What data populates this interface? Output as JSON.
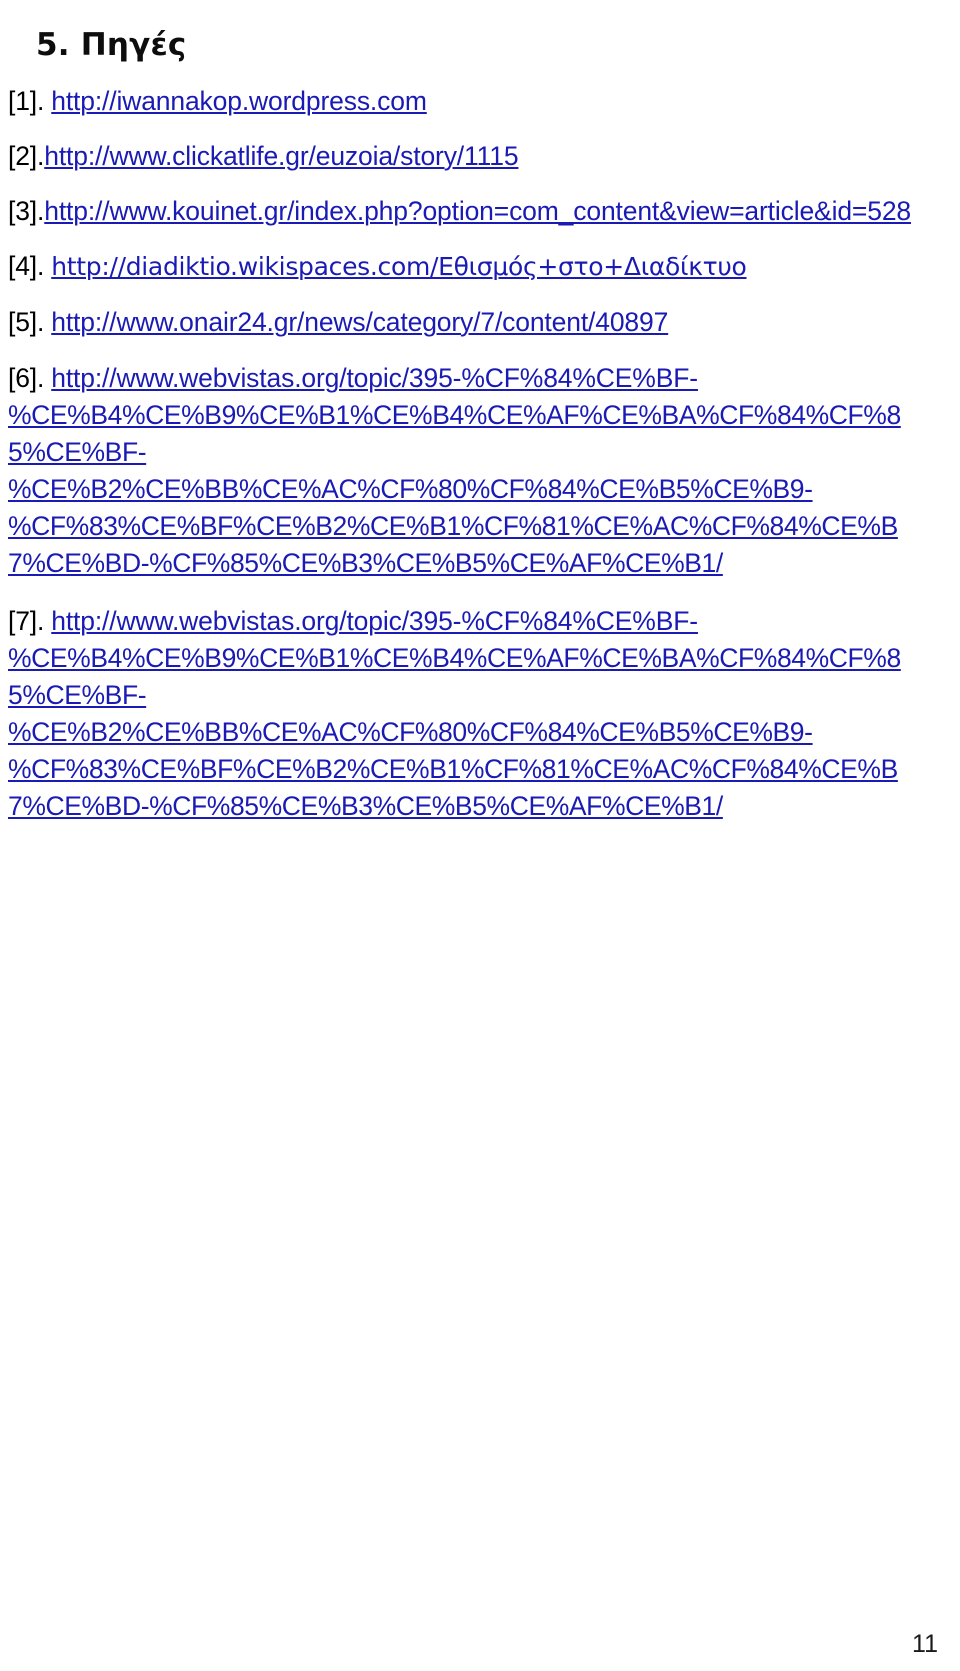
{
  "document": {
    "heading": "5. Πηγές",
    "page_number": "11",
    "link_color": "#1a1ab5",
    "text_color": "#0d0d0d"
  },
  "references": [
    {
      "marker": "[1].",
      "spacer": true,
      "lines": [
        "http://iwannakop.wordpress.com"
      ]
    },
    {
      "marker": "[2].",
      "spacer": false,
      "lines": [
        "http://www.clickatlife.gr/euzoia/story/1115"
      ]
    },
    {
      "marker": "[3].",
      "spacer": false,
      "lines": [
        "http://www.kouinet.gr/index.php?option=com_content&view=article&id=528"
      ]
    },
    {
      "marker": "[4].",
      "spacer": true,
      "greek": true,
      "lines": [
        "http://diadiktio.wikispaces.com/Εθισμός+στο+Διαδίκτυο"
      ]
    },
    {
      "marker": "[5].",
      "spacer": true,
      "lines": [
        "http://www.onair24.gr/news/category/7/content/40897"
      ]
    },
    {
      "marker": "[6].",
      "spacer": true,
      "wrapped": true,
      "lines": [
        "http://www.webvistas.org/topic/395-%CF%84%CE%BF-",
        "%CE%B4%CE%B9%CE%B1%CE%B4%CE%AF%CE%BA%CF%84%CF%8",
        "5%CE%BF-",
        "%CE%B2%CE%BB%CE%AC%CF%80%CF%84%CE%B5%CE%B9-",
        "%CF%83%CE%BF%CE%B2%CE%B1%CF%81%CE%AC%CF%84%CE%B",
        "7%CE%BD-%CF%85%CE%B3%CE%B5%CE%AF%CE%B1/"
      ]
    },
    {
      "marker": "[7].",
      "spacer": true,
      "wrapped": true,
      "lines": [
        "http://www.webvistas.org/topic/395-%CF%84%CE%BF-",
        "%CE%B4%CE%B9%CE%B1%CE%B4%CE%AF%CE%BA%CF%84%CF%8",
        "5%CE%BF-",
        "%CE%B2%CE%BB%CE%AC%CF%80%CF%84%CE%B5%CE%B9-",
        "%CF%83%CE%BF%CE%B2%CE%B1%CF%81%CE%AC%CF%84%CE%B",
        "7%CE%BD-%CF%85%CE%B3%CE%B5%CE%AF%CE%B1/"
      ]
    }
  ]
}
